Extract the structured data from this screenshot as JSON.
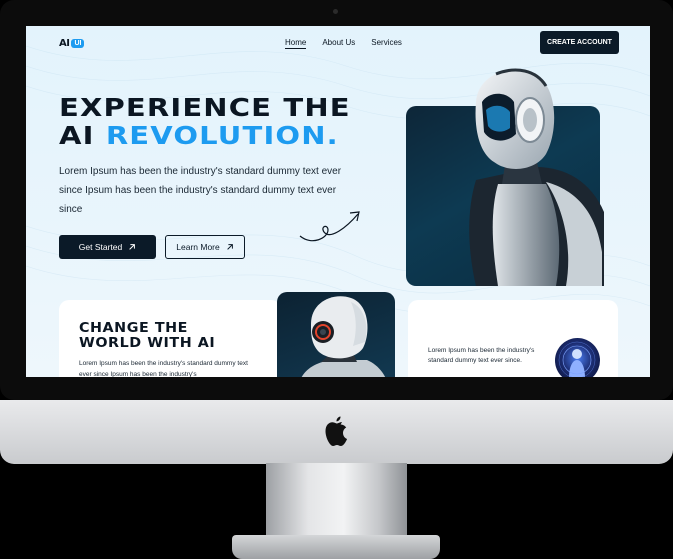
{
  "nav": {
    "logo_ai": "AI",
    "logo_ui": "UI",
    "items": [
      {
        "label": "Home"
      },
      {
        "label": "About Us"
      },
      {
        "label": "Services"
      }
    ],
    "cta_label": "CREATE ACCOUNT"
  },
  "hero": {
    "title_line1": "EXPERIENCE THE",
    "title_line2_plain": "AI ",
    "title_line2_accent": "REVOLUTION.",
    "description": "Lorem Ipsum has been the industry's standard dummy text ever since  Ipsum has been the industry's standard dummy text ever since",
    "primary_button": "Get Started",
    "secondary_button": "Learn More"
  },
  "features": {
    "card_title": "CHANGE THE WORLD WITH AI",
    "card_left_text": "Lorem Ipsum has been the industry's standard dummy text ever since  Ipsum has been the industry's",
    "card_right_text": "Lorem Ipsum has been the industry's standard dummy text ever since."
  },
  "colors": {
    "accent": "#1d9bf0",
    "dark": "#0b1a28",
    "background": "#e3f3fc"
  }
}
